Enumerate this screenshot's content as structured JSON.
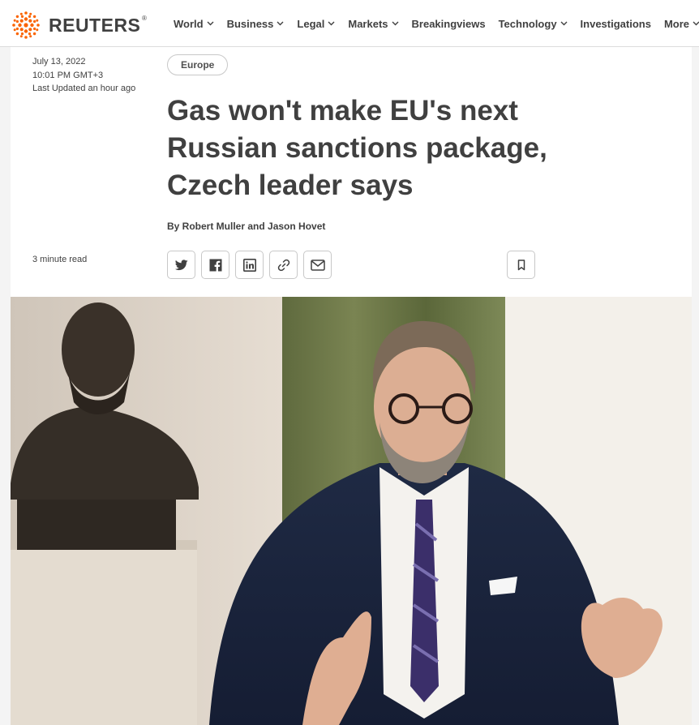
{
  "header": {
    "brand": "REUTERS",
    "brand_mark": "®",
    "nav": [
      "World",
      "Business",
      "Legal",
      "Markets",
      "Breakingviews",
      "Technology",
      "Investigations",
      "More"
    ],
    "nav_dropdown": [
      true,
      true,
      true,
      true,
      false,
      true,
      false,
      true
    ]
  },
  "article": {
    "date": "July 13, 2022",
    "time": "10:01 PM GMT+3",
    "updated": "Last Updated an hour ago",
    "read_time": "3 minute read",
    "tag": "Europe",
    "headline": "Gas won't make EU's next Russian sanctions package, Czech leader says",
    "byline": "By Robert Muller and Jason Hovet",
    "share_icons": [
      "twitter-icon",
      "facebook-icon",
      "linkedin-icon",
      "link-icon",
      "email-icon"
    ],
    "bookmark_icon": "bookmark-icon"
  },
  "colors": {
    "brand_orange": "#fa6400",
    "text": "#404040",
    "border": "#c8c8c8",
    "page_bg": "#f4f4f4"
  }
}
